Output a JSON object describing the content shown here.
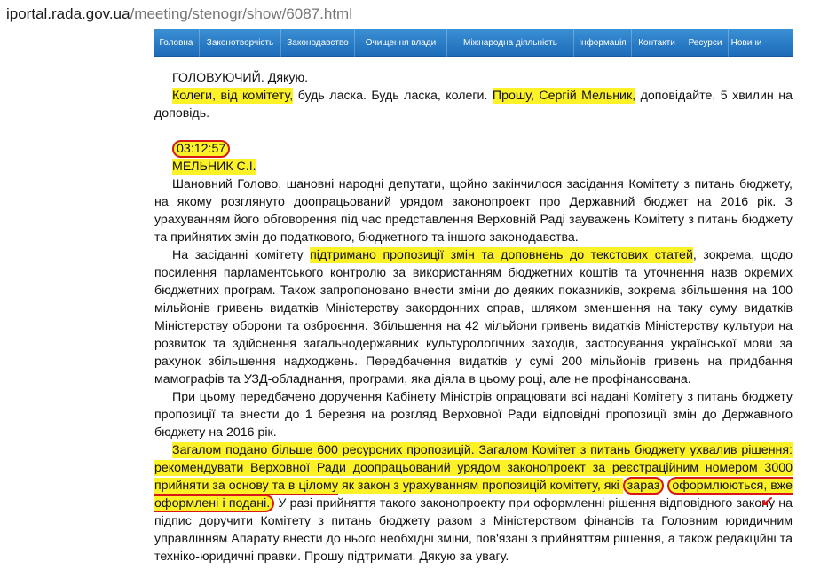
{
  "browser": {
    "url_domain": "iportal.rada.gov.ua",
    "url_path": "/meeting/stenogr/show/6087.html"
  },
  "nav": {
    "items": [
      "Головна",
      "Законотворчість",
      "Законодавство",
      "Очищення влади",
      "Міжнародна діяльність",
      "Інформація",
      "Контакти",
      "Ресурси",
      "Новини"
    ]
  },
  "transcript": {
    "p1": "ГОЛОВУЮЧИЙ. Дякую.",
    "p2": {
      "a": "Колеги, від комітету,",
      "b": " будь ласка. Будь ласка, колеги. ",
      "c": "Прошу, Сергій Мельник,",
      "d": " доповідайте, 5 хвилин на доповідь."
    },
    "timestamp": "03:12:57",
    "speaker": "МЕЛЬНИК С.І.",
    "p3": "Шановний Голово, шановні народні депутати, щойно закінчилося засідання Комітету з питань бюджету, на якому розглянуто доопрацьований урядом законопроект про Державний бюджет на 2016 рік. З урахуванням його обговорення під час представлення Верховній Раді зауважень Комітету з питань бюджету та прийнятих змін до податкового, бюджетного та іншого законодавства.",
    "p4": {
      "a": "На засіданні комітету ",
      "b": "підтримано пропозиції змін та доповнень до текстових статей",
      "c": ", зокрема, щодо посилення парламентського контролю за використанням бюджетних коштів та уточнення назв окремих бюджетних програм. Також запропоновано внести зміни до деяких показників, зокрема збільшення на 100 мільйонів гривень видатків Міністерству закордонних справ, шляхом зменшення на таку суму видатків Міністерству оборони та озброєння. Збільшення на 42 мільйони гривень видатків Міністерству культури на розвиток та здійснення загальнодержавних культурологічних заходів, застосування української мови за рахунок збільшення надходжень. Передбачення видатків у сумі 200 мільйонів гривень на придбання мамографів та УЗД-обладнання, програми, яка діяла в цьому році, але не профінансована."
    },
    "p5": "При цьому передбачено доручення Кабінету Міністрів опрацювати всі надані Комітету з питань бюджету пропозиції та внести до 1 березня на розгляд Верховної Ради відповідні пропозиції змін до Державного бюджету на 2016 рік.",
    "p6": {
      "a": "Загалом подано більше 600 ресурсних пропозицій. Загалом Комітет з питань бюджету ухвалив рішення: рекомендувати Верховної Ради доопрацьований урядом законопроект за реєстраційним номером 3000 ",
      "b": "прийняти за основу та в цілому",
      "c": " як закон з урахуванням пропозицій комітету, які ",
      "d": "зараз",
      "e": "оформлюються, вже оформлені і подані.",
      "f": " У разі прийняття такого законопроекту при оформленні рішення відповідного закону на підпис доручити Комітету з питань бюджету разом з Міністерством фінансів та Головним юридичним управлінням Апарату внести до нього необхідні зміни, пов'язані з прийняттям рішення, а також редакційні та техніко-юридичні правки. Прошу підтримати. Дякую за увагу."
    }
  },
  "colors": {
    "highlight": "#fdf227",
    "annotation": "#d81818",
    "nav_blue": "#1d6cb8"
  }
}
